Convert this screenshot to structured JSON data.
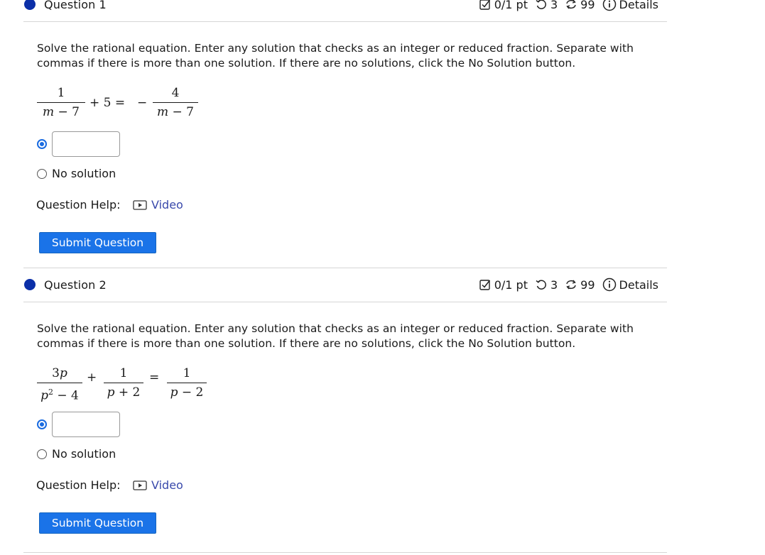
{
  "questions": [
    {
      "title": "Question 1",
      "meta": {
        "score": "0/1 pt",
        "retries": "3",
        "attempts": "99",
        "details_label": "Details"
      },
      "prompt": "Solve the rational equation. Enter any solution that checks as an integer or reduced fraction. Separate with commas if there is more than one solution. If there are no solutions, click the No Solution button.",
      "answer_value": "",
      "no_solution_label": "No solution",
      "help_label": "Question Help:",
      "video_label": "Video",
      "submit_label": "Submit Question"
    },
    {
      "title": "Question 2",
      "meta": {
        "score": "0/1 pt",
        "retries": "3",
        "attempts": "99",
        "details_label": "Details"
      },
      "prompt": "Solve the rational equation. Enter any solution that checks as an integer or reduced fraction. Separate with commas if there is more than one solution. If there are no solutions, click the No Solution button.",
      "answer_value": "",
      "no_solution_label": "No solution",
      "help_label": "Question Help:",
      "video_label": "Video",
      "submit_label": "Submit Question"
    }
  ],
  "colors": {
    "question_dot": "#0b2fa8",
    "radio_accent": "#1a6be0",
    "submit_button": "#1a73e8",
    "link": "#3949ab"
  },
  "icons": {
    "score": "checkbox-pencil-icon",
    "retries": "retry-icon",
    "attempts": "attempts-cycle-icon",
    "details": "info-circle-icon",
    "video": "play-video-icon"
  }
}
